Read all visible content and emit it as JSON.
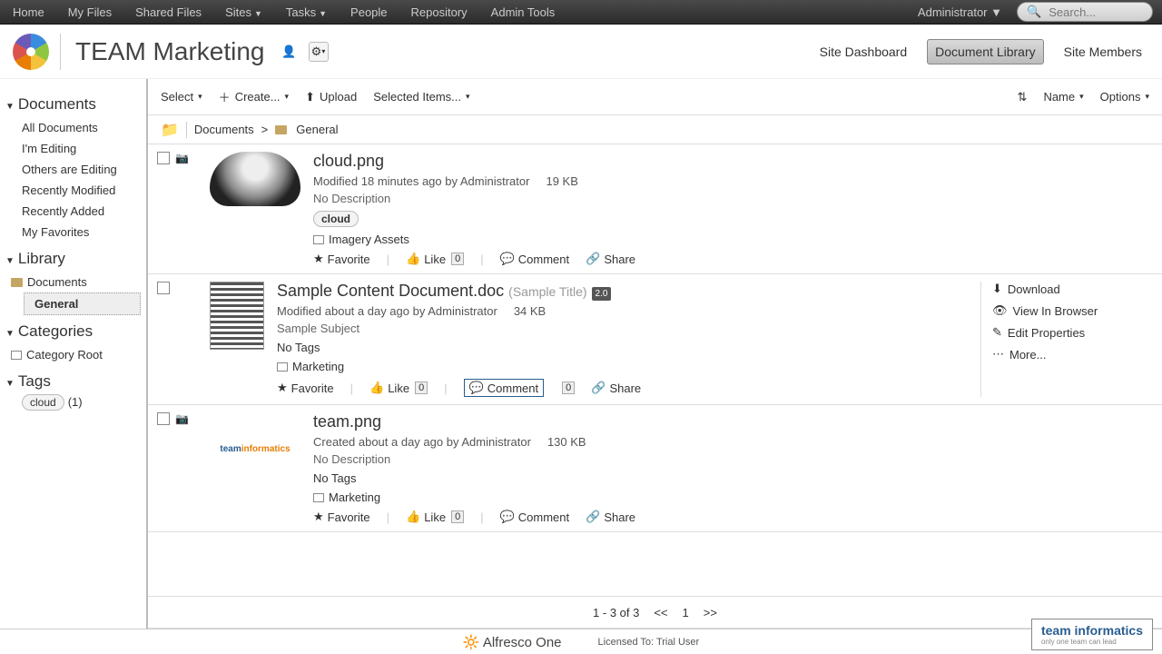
{
  "topnav": {
    "items": [
      "Home",
      "My Files",
      "Shared Files",
      "Sites",
      "Tasks",
      "People",
      "Repository",
      "Admin Tools"
    ],
    "dropdown_indices": [
      3,
      4
    ],
    "user": "Administrator",
    "search_placeholder": "Search..."
  },
  "site": {
    "title": "TEAM Marketing",
    "nav": [
      "Site Dashboard",
      "Document Library",
      "Site Members"
    ],
    "active_nav": 1
  },
  "sidebar": {
    "documents": {
      "title": "Documents",
      "items": [
        "All Documents",
        "I'm Editing",
        "Others are Editing",
        "Recently Modified",
        "Recently Added",
        "My Favorites"
      ]
    },
    "library": {
      "title": "Library",
      "root": "Documents",
      "child": "General"
    },
    "categories": {
      "title": "Categories",
      "root": "Category Root"
    },
    "tags": {
      "title": "Tags",
      "items": [
        {
          "name": "cloud",
          "count": "(1)"
        }
      ]
    }
  },
  "toolbar": {
    "select": "Select",
    "create": "Create...",
    "upload": "Upload",
    "selected": "Selected Items...",
    "sort": "Name",
    "options": "Options"
  },
  "breadcrumb": {
    "root": "Documents",
    "current": "General"
  },
  "documents": [
    {
      "title": "cloud.png",
      "subtitle": "",
      "meta": "Modified 18 minutes ago by Administrator",
      "size": "19 KB",
      "description": "No Description",
      "tags": [
        "cloud"
      ],
      "category": "Imagery Assets",
      "version": "",
      "has_view_icon": true,
      "thumb": "cloud",
      "hover": false
    },
    {
      "title": "Sample Content Document.doc",
      "subtitle": "(Sample Title)",
      "meta": "Modified about a day ago by Administrator",
      "size": "34 KB",
      "description": "Sample Subject",
      "tags_text": "No Tags",
      "category": "Marketing",
      "version": "2.0",
      "has_view_icon": false,
      "thumb": "doc",
      "hover": true,
      "comment_highlight": true
    },
    {
      "title": "team.png",
      "subtitle": "",
      "meta": "Created about a day ago by Administrator",
      "size": "130 KB",
      "description": "No Description",
      "tags_text": "No Tags",
      "category": "Marketing",
      "version": "",
      "has_view_icon": true,
      "thumb": "team",
      "hover": false
    }
  ],
  "hover_actions": [
    "Download",
    "View In Browser",
    "Edit Properties",
    "More..."
  ],
  "doc_actions": {
    "favorite": "Favorite",
    "like": "Like",
    "like_count": "0",
    "comment": "Comment",
    "share": "Share"
  },
  "pager": {
    "summary": "1 - 3 of 3",
    "prev": "<<",
    "page": "1",
    "next": ">>"
  },
  "footer": {
    "brand": "Alfresco One",
    "license": "Licensed To: Trial User",
    "badge_title": "team informatics",
    "badge_sub": "only one team can lead"
  }
}
